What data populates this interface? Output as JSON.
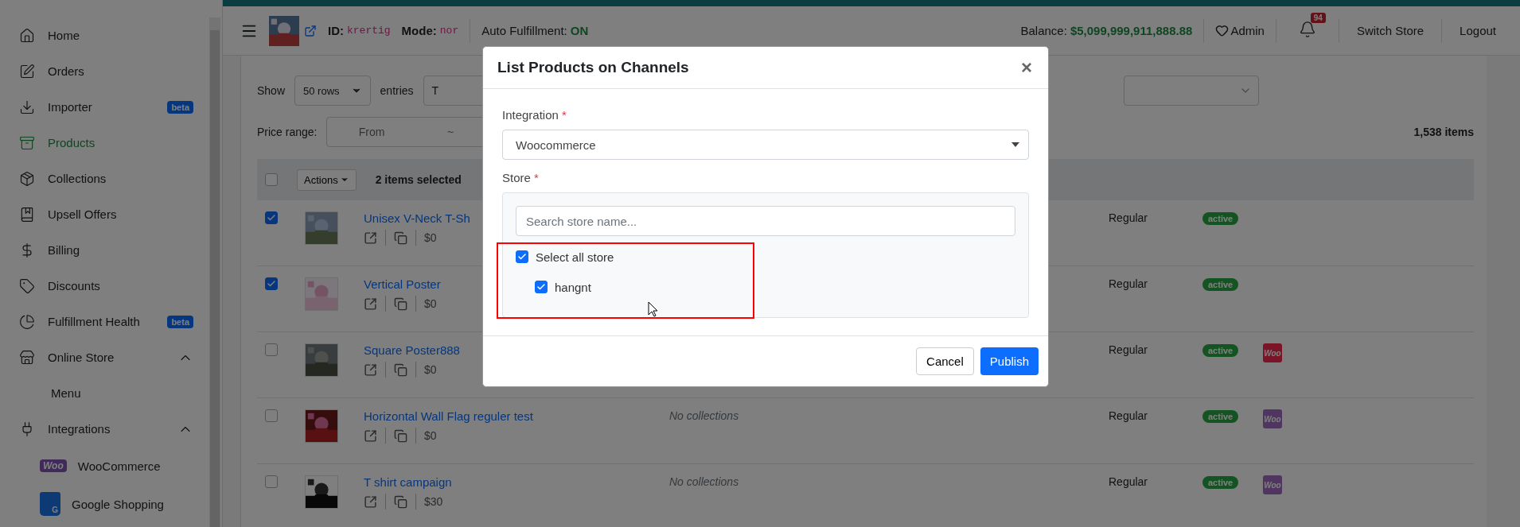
{
  "topbar": {
    "id_label": "ID:",
    "id_value": "krertig",
    "mode_label": "Mode:",
    "mode_value": "nor",
    "auto_label": "Auto Fulfillment:",
    "auto_value": "ON",
    "balance_label": "Balance:",
    "balance_value": "$5,099,999,911,888.88",
    "admin": "Admin",
    "notifications": "94",
    "switch_store": "Switch Store",
    "logout": "Logout"
  },
  "sidebar": {
    "items": [
      {
        "label": "Home",
        "selected": false
      },
      {
        "label": "Orders",
        "selected": false
      },
      {
        "label": "Importer",
        "badge": "beta",
        "selected": false
      },
      {
        "label": "Products",
        "selected": true
      },
      {
        "label": "Collections",
        "selected": false
      },
      {
        "label": "Upsell Offers",
        "selected": false
      },
      {
        "label": "Billing",
        "selected": false
      },
      {
        "label": "Discounts",
        "selected": false
      },
      {
        "label": "Fulfillment Health",
        "badge": "beta",
        "selected": false
      },
      {
        "label": "Online Store",
        "selected": false,
        "expanded": true,
        "children": [
          {
            "label": "Menu",
            "selected": false
          }
        ]
      },
      {
        "label": "Integrations",
        "selected": false,
        "expanded": true,
        "children": [
          {
            "label": "WooCommerce",
            "logo_text": "Woo",
            "selected": false
          },
          {
            "label": "Google Shopping",
            "logo_text": "G",
            "selected": false
          }
        ]
      }
    ]
  },
  "filters": {
    "show_label": "Show",
    "rows_select": "50 rows",
    "entries_label": "entries",
    "search_value": "T",
    "price_label": "Price range:",
    "price_from": "From",
    "price_sep": "~",
    "items_count": "1,538 items"
  },
  "table": {
    "actions": "Actions",
    "selection_text": "2 items selected",
    "select_all_checked": false,
    "rows": [
      {
        "checked": true,
        "name": "Unisex V-Neck T-Sh",
        "price": "$0",
        "type": "Regular",
        "status": "active"
      },
      {
        "checked": true,
        "name": "Vertical Poster",
        "price": "$0",
        "type": "Regular",
        "status": "active"
      },
      {
        "checked": false,
        "name": "Square Poster888",
        "price": "$0",
        "type": "Regular",
        "status": "active",
        "channel": {
          "text": "Woo",
          "color": "#7a1426"
        }
      },
      {
        "checked": false,
        "name": "Horizontal Wall Flag reguler test",
        "price": "$0",
        "collections": "No collections",
        "type": "Regular",
        "status": "active",
        "channel": {
          "text": "Woo",
          "color": "#4f3560"
        }
      },
      {
        "checked": false,
        "name": "T shirt campaign",
        "price": "$30",
        "collections": "No collections",
        "type": "Regular",
        "status": "active",
        "channel": {
          "text": "Woo",
          "color": "#4f3560"
        }
      }
    ]
  },
  "modal": {
    "title": "List Products on Channels",
    "close": "×",
    "integration_label": "Integration",
    "required_mark": "*",
    "integration_value": "Woocommerce",
    "store_label": "Store",
    "store_required_mark": "*",
    "search_placeholder": "Search store name...",
    "select_all": {
      "label": "Select all store",
      "checked": true
    },
    "stores": [
      {
        "label": "hangnt",
        "checked": true
      }
    ],
    "cancel": "Cancel",
    "publish": "Publish"
  }
}
